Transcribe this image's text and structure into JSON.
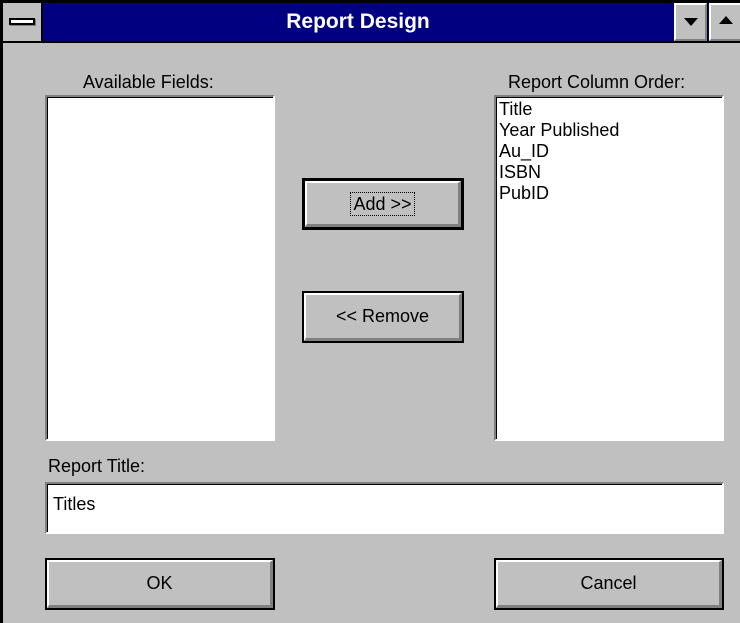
{
  "window": {
    "title": "Report Design"
  },
  "available_fields": {
    "label": "Available Fields:",
    "items": []
  },
  "report_column_order": {
    "label": "Report Column Order:",
    "items": [
      "Title",
      "Year Published",
      "Au_ID",
      "ISBN",
      "PubID"
    ]
  },
  "buttons": {
    "add": "Add >>",
    "remove": "<< Remove",
    "ok": "OK",
    "cancel": "Cancel"
  },
  "report_title": {
    "label": "Report Title:",
    "value": "Titles"
  },
  "colors": {
    "titlebar": "#000080",
    "face": "#c0c0c0"
  },
  "icons": {
    "system_menu": "system-menu-icon",
    "minimize": "minimize-arrow-icon",
    "maximize": "maximize-arrow-icon"
  }
}
